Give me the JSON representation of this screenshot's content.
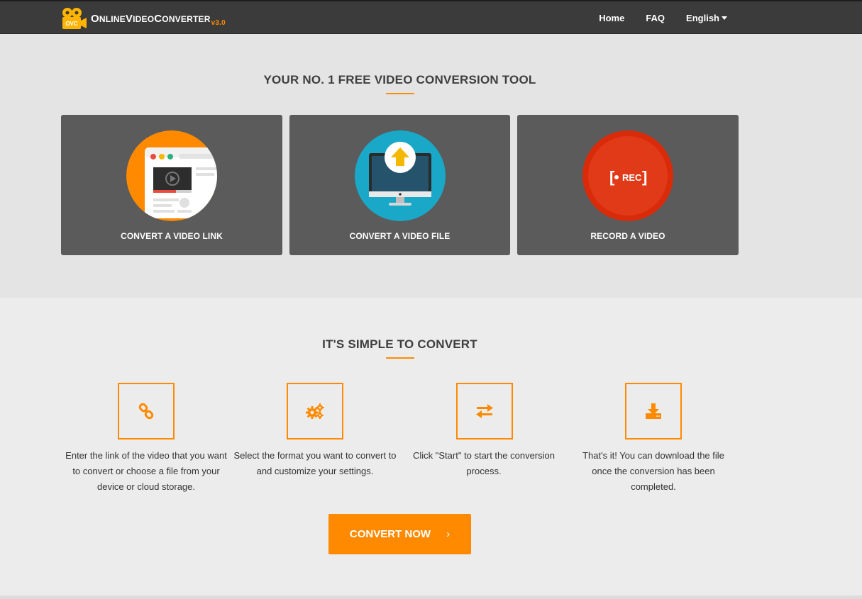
{
  "nav": {
    "brand_first": "O",
    "brand_online": "NLINE",
    "brand_v": "V",
    "brand_video": "IDEO",
    "brand_c": "C",
    "brand_converter": "ONVERTER",
    "brand_version": "v3.0",
    "logo_badge": "OVC",
    "links": [
      {
        "label": "Home"
      },
      {
        "label": "FAQ"
      },
      {
        "label": "English"
      }
    ]
  },
  "hero": {
    "title": "YOUR NO. 1 FREE VIDEO CONVERSION TOOL",
    "cards": [
      {
        "label": "CONVERT A VIDEO LINK",
        "icon": "browser-video-icon"
      },
      {
        "label": "CONVERT A VIDEO FILE",
        "icon": "monitor-upload-icon"
      },
      {
        "label": "RECORD A VIDEO",
        "icon": "rec-icon",
        "rec_text": "REC"
      }
    ]
  },
  "steps": {
    "title": "IT'S SIMPLE TO CONVERT",
    "items": [
      {
        "icon": "link-icon",
        "text": "Enter the link of the video that you want to convert or choose a file from your device or cloud storage."
      },
      {
        "icon": "gears-icon",
        "text": "Select the format you want to convert to and customize your settings."
      },
      {
        "icon": "exchange-icon",
        "text": "Click \"Start\" to start the conversion process."
      },
      {
        "icon": "download-icon",
        "text": "That's it! You can download the file once the conversion has been completed."
      }
    ],
    "cta_label": "CONVERT NOW",
    "cta_chevron": "›"
  },
  "colors": {
    "accent": "#ff8a00",
    "navbar": "#3b3b3b",
    "card": "#5b5b5b",
    "hero_bg": "#e4e4e4",
    "steps_bg": "#ececec",
    "link_circle": "#ff8a00",
    "file_circle": "#1aa8c8",
    "rec_circle": "#d92a0a"
  }
}
